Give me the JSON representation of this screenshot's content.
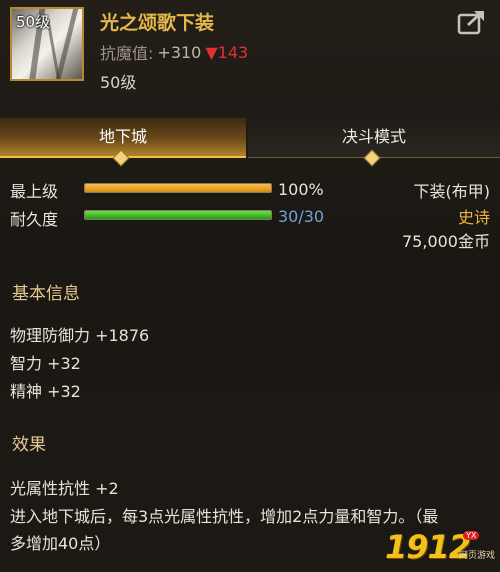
{
  "item": {
    "name": "光之颂歌下装",
    "icon_level": "50级",
    "resist_label": "抗魔值:",
    "resist_value": "+310",
    "resist_drop": "▼143",
    "required_level": "50级"
  },
  "tabs": [
    {
      "label": "地下城",
      "active": true
    },
    {
      "label": "决斗模式",
      "active": false
    }
  ],
  "stats": {
    "max_upgrade_label": "最上级",
    "max_upgrade_value": "100%",
    "max_upgrade_fraction": 1.0,
    "durability_label": "耐久度",
    "durability_value": "30/30",
    "durability_fraction": 1.0
  },
  "info": {
    "slot": "下装(布甲)",
    "rarity": "史诗",
    "price": "75,000金币"
  },
  "basic": {
    "title": "基本信息",
    "lines": [
      "物理防御力 +1876",
      "智力 +32",
      "精神 +32"
    ]
  },
  "effect": {
    "title": "效果",
    "lines": [
      "光属性抗性 +2",
      "进入地下城后，每3点光属性抗性，增加2点力量和智力。（最",
      "多增加40点）"
    ]
  },
  "watermark": {
    "brand": "1912",
    "badge": "YX",
    "sub": "网页游戏"
  },
  "colors": {
    "title_gold": "#e4b84a",
    "rarity_gold": "#f0b43a",
    "durability_blue": "#6fa3d8",
    "drop_red": "#e23030"
  }
}
